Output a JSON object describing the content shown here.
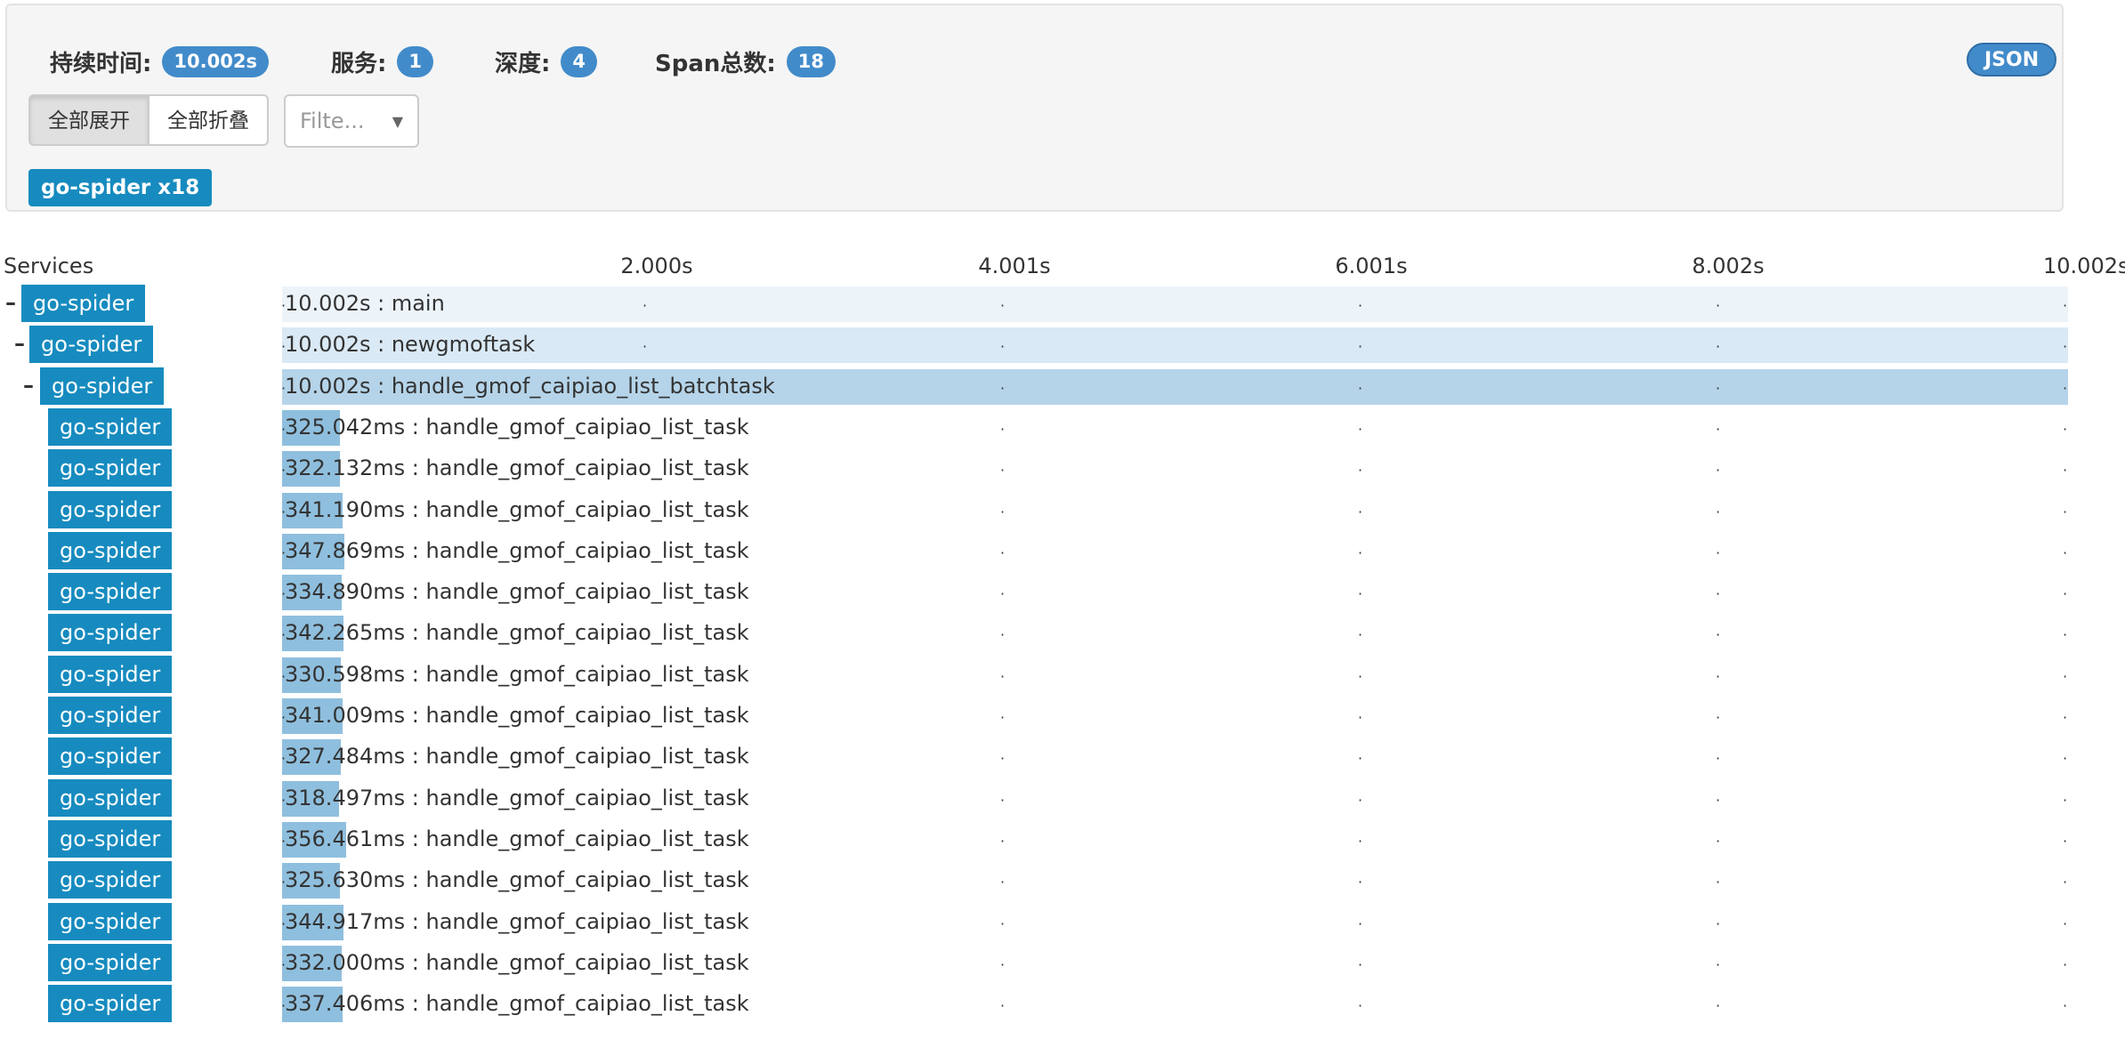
{
  "summary": {
    "duration_label": "持续时间:",
    "duration_value": "10.002s",
    "services_label": "服务:",
    "services_value": "1",
    "depth_label": "深度:",
    "depth_value": "4",
    "span_label": "Span总数:",
    "span_value": "18",
    "json_button": "JSON"
  },
  "controls": {
    "expand_all": "全部展开",
    "collapse_all": "全部折叠",
    "filter_placeholder": "Filte..."
  },
  "service_tags": [
    "go-spider x18"
  ],
  "timeline": {
    "services_header": "Services",
    "ticks": [
      "2.000s",
      "4.001s",
      "6.001s",
      "8.002s",
      "10.002s"
    ]
  },
  "trace_total_ms": 10002,
  "colors": {
    "accent": "#428bca",
    "service": "#178bbf",
    "span_bar": "#8fbfde",
    "row_depth1": "#ecf4fa",
    "row_depth2": "#d9e9f5",
    "row_depth3": "#b5d4e9"
  },
  "spans": [
    {
      "service": "go-spider",
      "depth": 0,
      "toggle": "–",
      "duration_ms": 10002,
      "duration_label": "10.002s",
      "name": "main"
    },
    {
      "service": "go-spider",
      "depth": 1,
      "toggle": "–",
      "duration_ms": 10002,
      "duration_label": "10.002s",
      "name": "newgmoftask"
    },
    {
      "service": "go-spider",
      "depth": 2,
      "toggle": "–",
      "duration_ms": 10002,
      "duration_label": "10.002s",
      "name": "handle_gmof_caipiao_list_batchtask"
    },
    {
      "service": "go-spider",
      "depth": 3,
      "toggle": "",
      "duration_ms": 325.042,
      "duration_label": "325.042ms",
      "name": "handle_gmof_caipiao_list_task"
    },
    {
      "service": "go-spider",
      "depth": 3,
      "toggle": "",
      "duration_ms": 322.132,
      "duration_label": "322.132ms",
      "name": "handle_gmof_caipiao_list_task"
    },
    {
      "service": "go-spider",
      "depth": 3,
      "toggle": "",
      "duration_ms": 341.19,
      "duration_label": "341.190ms",
      "name": "handle_gmof_caipiao_list_task"
    },
    {
      "service": "go-spider",
      "depth": 3,
      "toggle": "",
      "duration_ms": 347.869,
      "duration_label": "347.869ms",
      "name": "handle_gmof_caipiao_list_task"
    },
    {
      "service": "go-spider",
      "depth": 3,
      "toggle": "",
      "duration_ms": 334.89,
      "duration_label": "334.890ms",
      "name": "handle_gmof_caipiao_list_task"
    },
    {
      "service": "go-spider",
      "depth": 3,
      "toggle": "",
      "duration_ms": 342.265,
      "duration_label": "342.265ms",
      "name": "handle_gmof_caipiao_list_task"
    },
    {
      "service": "go-spider",
      "depth": 3,
      "toggle": "",
      "duration_ms": 330.598,
      "duration_label": "330.598ms",
      "name": "handle_gmof_caipiao_list_task"
    },
    {
      "service": "go-spider",
      "depth": 3,
      "toggle": "",
      "duration_ms": 341.009,
      "duration_label": "341.009ms",
      "name": "handle_gmof_caipiao_list_task"
    },
    {
      "service": "go-spider",
      "depth": 3,
      "toggle": "",
      "duration_ms": 327.484,
      "duration_label": "327.484ms",
      "name": "handle_gmof_caipiao_list_task"
    },
    {
      "service": "go-spider",
      "depth": 3,
      "toggle": "",
      "duration_ms": 318.497,
      "duration_label": "318.497ms",
      "name": "handle_gmof_caipiao_list_task"
    },
    {
      "service": "go-spider",
      "depth": 3,
      "toggle": "",
      "duration_ms": 356.461,
      "duration_label": "356.461ms",
      "name": "handle_gmof_caipiao_list_task"
    },
    {
      "service": "go-spider",
      "depth": 3,
      "toggle": "",
      "duration_ms": 325.63,
      "duration_label": "325.630ms",
      "name": "handle_gmof_caipiao_list_task"
    },
    {
      "service": "go-spider",
      "depth": 3,
      "toggle": "",
      "duration_ms": 344.917,
      "duration_label": "344.917ms",
      "name": "handle_gmof_caipiao_list_task"
    },
    {
      "service": "go-spider",
      "depth": 3,
      "toggle": "",
      "duration_ms": 332.0,
      "duration_label": "332.000ms",
      "name": "handle_gmof_caipiao_list_task"
    },
    {
      "service": "go-spider",
      "depth": 3,
      "toggle": "",
      "duration_ms": 337.406,
      "duration_label": "337.406ms",
      "name": "handle_gmof_caipiao_list_task"
    }
  ]
}
